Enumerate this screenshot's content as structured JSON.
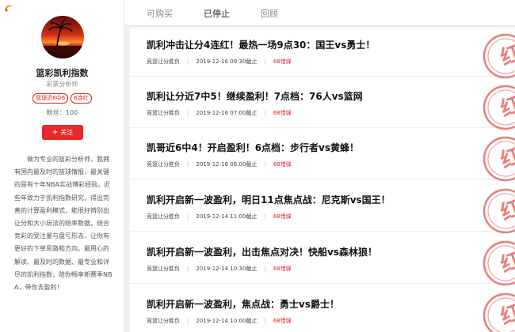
{
  "profile": {
    "name": "篮彩凯利指数",
    "role": "彩票分析师",
    "tags": [
      "篮球近6中6",
      "6连红"
    ],
    "fans_label": "粉丝：",
    "fans_count": "100",
    "follow_plus": "+",
    "follow_label": "关注",
    "description": "做为专业的篮彩分析师，我拥有国内最及时的篮球情报，最关键的是有十年NBA实战博彩经验。近些年致力于凯利指数研究，得出完善的计算盈利模式，能很好辨别出让分和大小玩法的赔率数据，结合竞彩的受注量与盘亏形态，让你有更好的下单思路和方向。最用心的解读、最及时的数据、最专业和详尽的凯利指数，陪你畅享新赛季NBA，带你去盈利！"
  },
  "tabs": [
    {
      "label": "可购买",
      "active": false
    },
    {
      "label": "已停止",
      "active": true
    },
    {
      "label": "回顾",
      "active": false
    }
  ],
  "articles": [
    {
      "title": "凯利冲击让分4连红！最热一场9点30：国王vs勇士！",
      "category": "竞篮让分胜负",
      "time": "2019-12-16 09:30截止",
      "price": "68惜弹"
    },
    {
      "title": "凯利让分近7中5！继续盈利！7点档：76人vs篮网",
      "category": "竞篮让分胜负",
      "time": "2019-12-16 07:00截止",
      "price": "68惜弹"
    },
    {
      "title": "凯哥近6中4！开启盈利！6点档：步行者vs黄蜂！",
      "category": "竞篮让分胜负",
      "time": "2019-12-16 06:00截止",
      "price": "68惜弹"
    },
    {
      "title": "凯利开启新一波盈利，明日11点焦点战：尼克斯vs国王！",
      "category": "竞篮让分胜负",
      "time": "2019-12-14 11:00截止",
      "price": "68惜弹"
    },
    {
      "title": "凯利开启新一波盈利，出击焦点对决！快船vs森林狼！",
      "category": "竞篮让分胜负",
      "time": "2019-12-14 10:30截止",
      "price": "68惜弹"
    },
    {
      "title": "凯利开启新一波盈利，焦点战：勇士vs爵士！",
      "category": "竞篮让分胜负",
      "time": "2019-12-14 10:00截止",
      "price": "68惜弹"
    }
  ],
  "stamp_text": "红",
  "colors": {
    "accent": "#e8282b",
    "stamp": "#e46a6a"
  }
}
